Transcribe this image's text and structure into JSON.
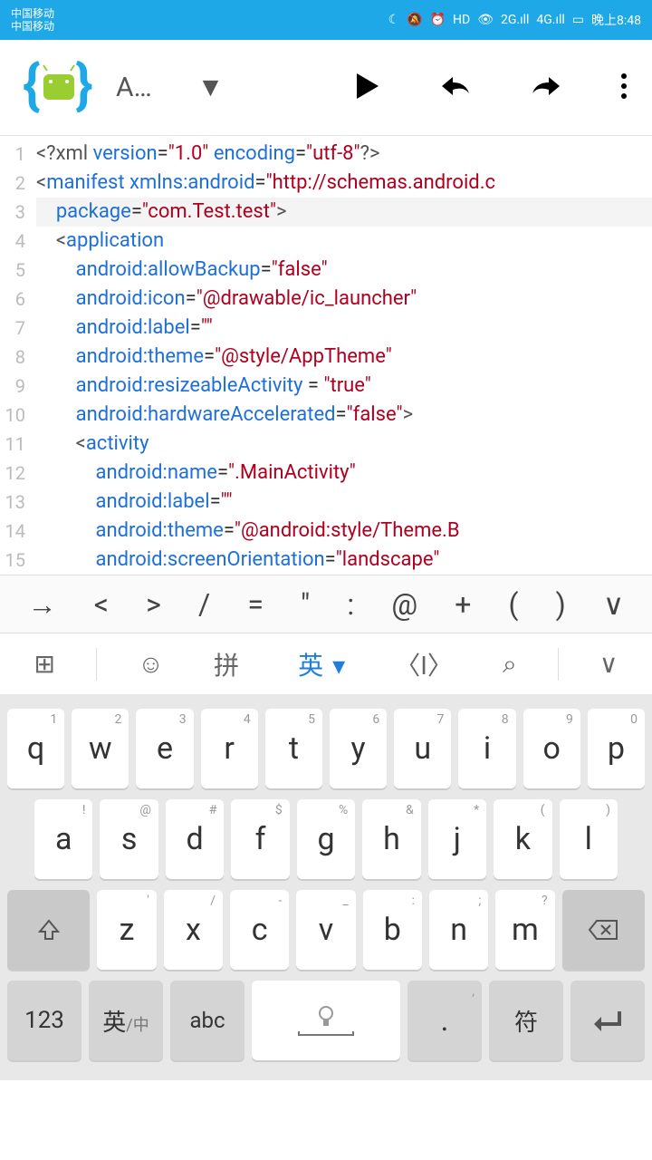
{
  "status_bar": {
    "carrier1": "中国移动",
    "carrier2": "中国移动",
    "time": "晚上8:48"
  },
  "app_bar": {
    "file_label": "A…"
  },
  "code_lines": [
    {
      "n": "1",
      "segs": [
        {
          "c": "k-punc",
          "t": "<?xml "
        },
        {
          "c": "k-attr",
          "t": "version"
        },
        {
          "c": "k-op",
          "t": "="
        },
        {
          "c": "k-str",
          "t": "\"1.0\""
        },
        {
          "c": "k-punc",
          "t": " "
        },
        {
          "c": "k-attr",
          "t": "encoding"
        },
        {
          "c": "k-op",
          "t": "="
        },
        {
          "c": "k-str",
          "t": "\"utf-8\""
        },
        {
          "c": "k-punc",
          "t": "?>"
        }
      ]
    },
    {
      "n": "2",
      "segs": [
        {
          "c": "k-punc",
          "t": "<"
        },
        {
          "c": "k-tag",
          "t": "manifest"
        },
        {
          "c": "k-punc",
          "t": " "
        },
        {
          "c": "k-attr",
          "t": "xmlns:android"
        },
        {
          "c": "k-op",
          "t": "="
        },
        {
          "c": "k-str",
          "t": "\"http://schemas.android.c"
        }
      ]
    },
    {
      "n": "3",
      "hl": true,
      "segs": [
        {
          "c": "k-punc",
          "t": "    "
        },
        {
          "c": "k-attr",
          "t": "package"
        },
        {
          "c": "k-op",
          "t": "="
        },
        {
          "c": "k-str",
          "t": "\"com.Test.test\""
        },
        {
          "c": "k-punc",
          "t": ">"
        }
      ]
    },
    {
      "n": "4",
      "segs": [
        {
          "c": "k-punc",
          "t": "    <"
        },
        {
          "c": "k-tag",
          "t": "application"
        }
      ]
    },
    {
      "n": "5",
      "segs": [
        {
          "c": "k-punc",
          "t": "        "
        },
        {
          "c": "k-attr",
          "t": "android:allowBackup"
        },
        {
          "c": "k-op",
          "t": "="
        },
        {
          "c": "k-str",
          "t": "\"false\""
        }
      ]
    },
    {
      "n": "6",
      "segs": [
        {
          "c": "k-punc",
          "t": "        "
        },
        {
          "c": "k-attr",
          "t": "android:icon"
        },
        {
          "c": "k-op",
          "t": "="
        },
        {
          "c": "k-str",
          "t": "\"@drawable/ic_launcher\""
        }
      ]
    },
    {
      "n": "7",
      "segs": [
        {
          "c": "k-punc",
          "t": "        "
        },
        {
          "c": "k-attr",
          "t": "android:label"
        },
        {
          "c": "k-op",
          "t": "="
        },
        {
          "c": "k-str",
          "t": "\"\""
        }
      ]
    },
    {
      "n": "8",
      "segs": [
        {
          "c": "k-punc",
          "t": "        "
        },
        {
          "c": "k-attr",
          "t": "android:theme"
        },
        {
          "c": "k-op",
          "t": "="
        },
        {
          "c": "k-str",
          "t": "\"@style/AppTheme\""
        }
      ]
    },
    {
      "n": "9",
      "segs": [
        {
          "c": "k-punc",
          "t": "        "
        },
        {
          "c": "k-attr",
          "t": "android:resizeableActivity"
        },
        {
          "c": "k-op",
          "t": " = "
        },
        {
          "c": "k-str",
          "t": "\"true\""
        }
      ]
    },
    {
      "n": "10",
      "segs": [
        {
          "c": "k-punc",
          "t": "        "
        },
        {
          "c": "k-attr",
          "t": "android:hardwareAccelerated"
        },
        {
          "c": "k-op",
          "t": "="
        },
        {
          "c": "k-str",
          "t": "\"false\""
        },
        {
          "c": "k-punc",
          "t": ">"
        }
      ]
    },
    {
      "n": "11",
      "segs": [
        {
          "c": "k-punc",
          "t": "        <"
        },
        {
          "c": "k-tag",
          "t": "activity"
        }
      ]
    },
    {
      "n": "12",
      "segs": [
        {
          "c": "k-punc",
          "t": "            "
        },
        {
          "c": "k-attr",
          "t": "android:name"
        },
        {
          "c": "k-op",
          "t": "="
        },
        {
          "c": "k-str",
          "t": "\".MainActivity\""
        }
      ]
    },
    {
      "n": "13",
      "segs": [
        {
          "c": "k-punc",
          "t": "            "
        },
        {
          "c": "k-attr",
          "t": "android:label"
        },
        {
          "c": "k-op",
          "t": "="
        },
        {
          "c": "k-str",
          "t": "\"\""
        }
      ]
    },
    {
      "n": "14",
      "segs": [
        {
          "c": "k-punc",
          "t": "            "
        },
        {
          "c": "k-attr",
          "t": "android:theme"
        },
        {
          "c": "k-op",
          "t": "="
        },
        {
          "c": "k-str",
          "t": "\"@android:style/Theme.B"
        }
      ]
    },
    {
      "n": "15",
      "segs": [
        {
          "c": "k-punc",
          "t": "            "
        },
        {
          "c": "k-attr",
          "t": "android:screenOrientation"
        },
        {
          "c": "k-op",
          "t": "="
        },
        {
          "c": "k-str",
          "t": "\"landscape\""
        }
      ]
    }
  ],
  "symbol_bar": [
    "→",
    "<",
    ">",
    "/",
    "=",
    "\"",
    ":",
    "@",
    "+",
    "(",
    ")",
    "∨"
  ],
  "ime_bar": {
    "grid": "⊞",
    "emoji": "☺",
    "pinyin": "拼",
    "english": "英",
    "cursor": "〈I〉",
    "search": "⌕",
    "collapse": "∨"
  },
  "keyboard": {
    "row1": [
      {
        "s": "1",
        "m": "q"
      },
      {
        "s": "2",
        "m": "w"
      },
      {
        "s": "3",
        "m": "e"
      },
      {
        "s": "4",
        "m": "r"
      },
      {
        "s": "5",
        "m": "t"
      },
      {
        "s": "6",
        "m": "y"
      },
      {
        "s": "7",
        "m": "u"
      },
      {
        "s": "8",
        "m": "i"
      },
      {
        "s": "9",
        "m": "o"
      },
      {
        "s": "0",
        "m": "p"
      }
    ],
    "row2": [
      {
        "s": "!",
        "m": "a"
      },
      {
        "s": "@",
        "m": "s"
      },
      {
        "s": "#",
        "m": "d"
      },
      {
        "s": "$",
        "m": "f"
      },
      {
        "s": "%",
        "m": "g"
      },
      {
        "s": "&",
        "m": "h"
      },
      {
        "s": "*",
        "m": "j"
      },
      {
        "s": "(",
        "m": "k"
      },
      {
        "s": ")",
        "m": "l"
      }
    ],
    "row3": [
      {
        "s": "'",
        "m": "z"
      },
      {
        "s": "/",
        "m": "x"
      },
      {
        "s": "-",
        "m": "c"
      },
      {
        "s": "_",
        "m": "v"
      },
      {
        "s": ":",
        "m": "b"
      },
      {
        "s": ";",
        "m": "n"
      },
      {
        "s": "?",
        "m": "m"
      }
    ],
    "bottom": {
      "num": "123",
      "lang": "英",
      "lang_sub": "/中",
      "abc": "abc",
      "comma": ",",
      "period": ".",
      "symbol": "符"
    }
  }
}
